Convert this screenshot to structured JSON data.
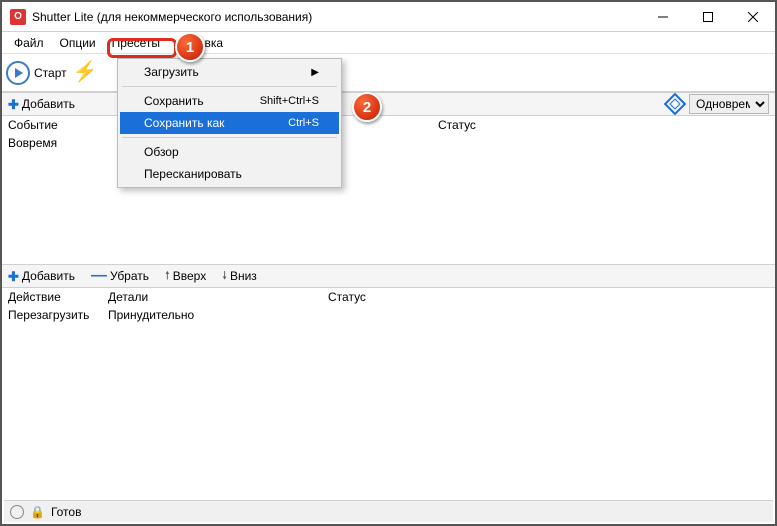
{
  "title": "Shutter Lite (для некоммерческого использования)",
  "menubar": {
    "file": "Файл",
    "options": "Опции",
    "presets": "Пресеты",
    "help": "Справка"
  },
  "toolbar": {
    "start": "Старт"
  },
  "dropdown": {
    "load": "Загрузить",
    "save": "Сохранить",
    "save_shortcut": "Shift+Ctrl+S",
    "save_as": "Сохранить как",
    "save_as_shortcut": "Ctrl+S",
    "browse": "Обзор",
    "rescan": "Пересканировать"
  },
  "topbar": {
    "add": "Добавить",
    "right_label": "Одноврем"
  },
  "topHeaders": {
    "event": "Событие",
    "status": "Статус"
  },
  "topRow": {
    "event": "Вовремя"
  },
  "bottombar": {
    "add": "Добавить",
    "remove": "Убрать",
    "up": "Вверх",
    "down": "Вниз"
  },
  "bottomHeaders": {
    "action": "Действие",
    "details": "Детали",
    "status": "Статус"
  },
  "bottomRow": {
    "action": "Перезагрузить",
    "details": "Принудительно"
  },
  "status": {
    "ready": "Готов"
  },
  "markers": {
    "m1": "1",
    "m2": "2"
  }
}
